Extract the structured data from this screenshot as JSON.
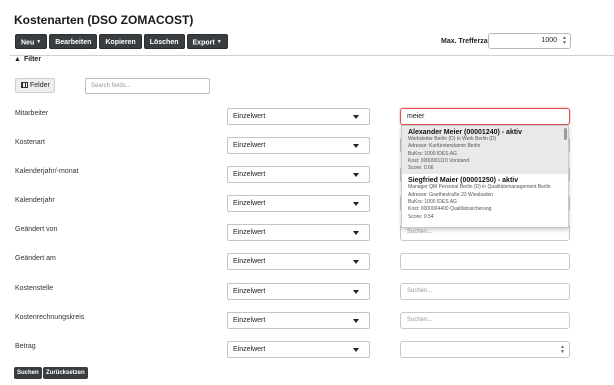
{
  "page_title": "Kostenarten (DSO ZOMACOST)",
  "toolbar": {
    "new_label": "Neu",
    "edit_label": "Bearbeiten",
    "copy_label": "Kopieren",
    "delete_label": "Löschen",
    "export_label": "Export"
  },
  "max_hits": {
    "label": "Max. Trefferzahl",
    "value": "1000"
  },
  "filter": {
    "header": "Filter",
    "fields_button": "Felder",
    "search_placeholder": "Search fields..."
  },
  "rows": [
    {
      "label": "Mitarbeiter",
      "operator": "Einzelwert",
      "value": "meier",
      "placeholder": ""
    },
    {
      "label": "Kostenart",
      "operator": "Einzelwert",
      "value": "",
      "placeholder": ""
    },
    {
      "label": "Kalenderjahr/-monat",
      "operator": "Einzelwert",
      "value": "",
      "placeholder": ""
    },
    {
      "label": "Kalenderjahr",
      "operator": "Einzelwert",
      "value": "",
      "placeholder": ""
    },
    {
      "label": "Geändert von",
      "operator": "Einzelwert",
      "value": "",
      "placeholder": "Suchen..."
    },
    {
      "label": "Geändert am",
      "operator": "Einzelwert",
      "value": "",
      "placeholder": ""
    },
    {
      "label": "Kostenstelle",
      "operator": "Einzelwert",
      "value": "",
      "placeholder": "Suchen..."
    },
    {
      "label": "Kostenrechnungskreis",
      "operator": "Einzelwert",
      "value": "",
      "placeholder": "Suchen..."
    },
    {
      "label": "Betrag",
      "operator": "Einzelwert",
      "value": "",
      "placeholder": ""
    }
  ],
  "suggestions": [
    {
      "name": "Alexander Meier (00001240) - aktiv",
      "lines": [
        "Werksleiter Berlin (D) in Werk Berlin (D)",
        "Adresse: Kurfürstendamm Berlin",
        "BuKrs: 1000 IDES AG",
        "Kost: 0000001110 Vorstand",
        "Score: 0.66"
      ]
    },
    {
      "name": "Siegfried Maier (00001250) - aktiv",
      "lines": [
        "Manager QM Personal Berlin (D) in Qualitätsmanagement Berlin",
        "Adresse: Goethestraße 23 Wiesbaden",
        "BuKrs: 1000 IDES AG",
        "Kost: 0000004400 Qualitätssicherung",
        "Score: 0.54"
      ]
    }
  ],
  "buttons": {
    "search": "Suchen",
    "reset": "Zurücksetzen"
  },
  "colors": {
    "button_dark": "#3a3d3f",
    "active_border": "#e05050",
    "highlight_row": "#e9e9e9"
  }
}
